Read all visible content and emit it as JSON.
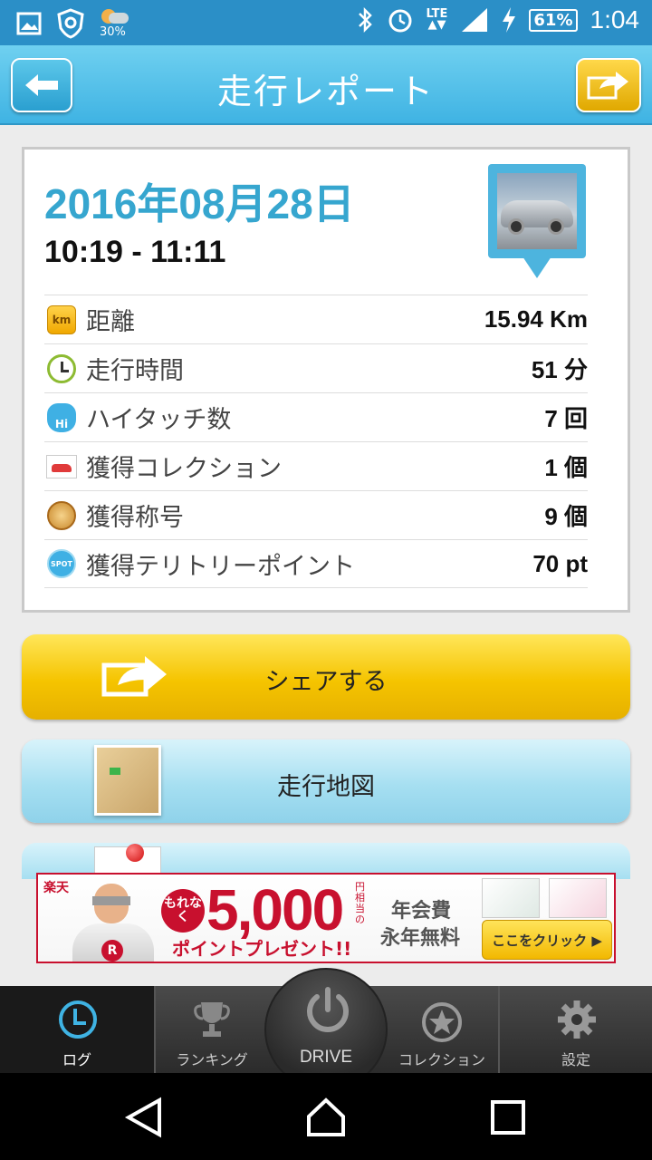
{
  "status_bar": {
    "weather_percent": "30%",
    "network": "LTE",
    "battery": "61%",
    "time": "1:04"
  },
  "header": {
    "title": "走行レポート",
    "back_icon": "arrow-left-icon",
    "share_icon": "share-arrow-icon"
  },
  "report": {
    "date": "2016年08月28日",
    "time_range": "10:19 - 11:11",
    "stats": [
      {
        "icon": "km-icon",
        "icon_text": "km",
        "label": "距離",
        "value": "15.94 Km"
      },
      {
        "icon": "clock-icon",
        "icon_text": "",
        "label": "走行時間",
        "value": "51 分"
      },
      {
        "icon": "high-touch-icon",
        "icon_text": "Hi",
        "label": "ハイタッチ数",
        "value": "7 回"
      },
      {
        "icon": "collection-car-icon",
        "icon_text": "",
        "label": "獲得コレクション",
        "value": "1 個"
      },
      {
        "icon": "medal-icon",
        "icon_text": "",
        "label": "獲得称号",
        "value": "9 個"
      },
      {
        "icon": "spot-icon",
        "icon_text": "SPOT",
        "label": "獲得テリトリーポイント",
        "value": "70 pt"
      }
    ]
  },
  "actions": {
    "share_label": "シェアする",
    "map_label": "走行地図"
  },
  "ad": {
    "brand": "楽天",
    "badge": "もれなく",
    "amount": "5,000",
    "unit": "円相当の",
    "sub": "ポイントプレゼント!!",
    "fee_line1": "年会費",
    "fee_line2": "永年無料",
    "cta": "ここをクリック ▶",
    "accent": "#c8102e"
  },
  "tabs": {
    "log": "ログ",
    "ranking": "ランキング",
    "drive": "DRIVE",
    "collection": "コレクション",
    "settings": "設定"
  },
  "colors": {
    "header": "#3fb3e3",
    "status_bar": "#2b8fc7",
    "date": "#36a6cf",
    "share_button": "#f5c400",
    "map_button": "#a6dff1"
  }
}
